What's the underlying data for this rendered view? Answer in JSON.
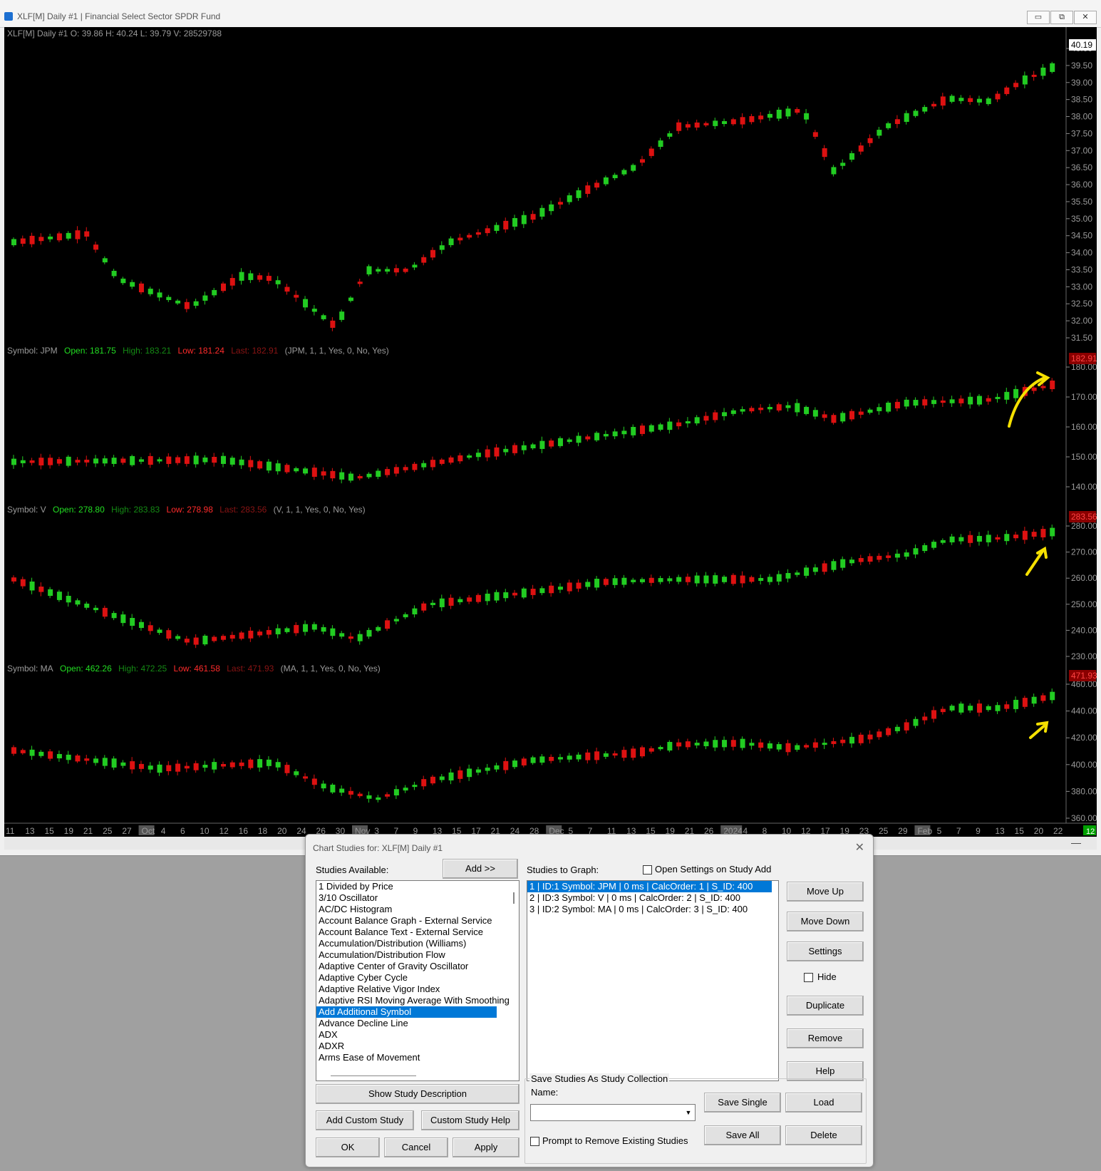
{
  "window": {
    "title": "XLF[M]  Daily #1 | Financial Select Sector SPDR Fund",
    "minimize": "▭",
    "restore": "⧉",
    "close": "✕"
  },
  "chart": {
    "main_header": "XLF[M]  Daily #1 O: 39.86 H: 40.24 L: 39.79 V: 28529788",
    "last_price_label": "40.19",
    "studies": [
      {
        "symbol_label": "Symbol: JPM",
        "open": "Open: 181.75",
        "high": "High: 183.21",
        "low": "Low: 181.24",
        "last": "Last: 182.91",
        "params": "(JPM, 1, 1, Yes, 0, No, Yes)",
        "price_label": "182.91"
      },
      {
        "symbol_label": "Symbol: V",
        "open": "Open: 278.80",
        "high": "High: 283.83",
        "low": "Low: 278.98",
        "last": "Last: 283.56",
        "params": "(V, 1, 1, Yes, 0, No, Yes)",
        "price_label": "283.56"
      },
      {
        "symbol_label": "Symbol: MA",
        "open": "Open: 462.26",
        "high": "High: 472.25",
        "low": "Low: 461.58",
        "last": "Last: 471.93",
        "params": "(MA, 1, 1, Yes, 0, No, Yes)",
        "price_label": "471.93"
      }
    ],
    "axis_main": [
      "40.00",
      "39.50",
      "39.00",
      "38.50",
      "38.00",
      "37.50",
      "37.00",
      "36.50",
      "36.00",
      "35.50",
      "35.00",
      "34.50",
      "34.00",
      "33.50",
      "33.00",
      "32.50",
      "32.00",
      "31.50"
    ],
    "axis_jpm": [
      "180.00",
      "170.00",
      "160.00",
      "150.00",
      "140.00"
    ],
    "axis_v": [
      "280.00",
      "270.00",
      "260.00",
      "250.00",
      "240.00",
      "230.00"
    ],
    "axis_ma": [
      "460.00",
      "440.00",
      "420.00",
      "400.00",
      "380.00",
      "360.00"
    ],
    "date_labels": [
      "11",
      "13",
      "15",
      "19",
      "21",
      "25",
      "27",
      "Oct",
      "4",
      "6",
      "10",
      "12",
      "16",
      "18",
      "20",
      "24",
      "26",
      "30",
      "Nov",
      "3",
      "7",
      "9",
      "13",
      "15",
      "17",
      "21",
      "24",
      "28",
      "Dec",
      "5",
      "7",
      "11",
      "13",
      "15",
      "19",
      "21",
      "26",
      "2024",
      "4",
      "8",
      "10",
      "12",
      "17",
      "19",
      "23",
      "25",
      "29",
      "Feb",
      "5",
      "7",
      "9",
      "13",
      "15",
      "20",
      "22"
    ],
    "bar_count": "12",
    "colors": {
      "up": "#22cc22",
      "down": "#dd1111",
      "background": "#000000",
      "annotation": "#f5e000"
    }
  },
  "dialog": {
    "title": "Chart Studies for: XLF[M]  Daily #1",
    "studies_available_label": "Studies Available:",
    "add_button": "Add >>",
    "studies_to_graph_label": "Studies to Graph:",
    "open_settings_label": "Open Settings on Study Add",
    "available": [
      "1 Divided by Price",
      "3/10 Oscillator",
      "AC/DC Histogram",
      "Account Balance Graph - External Service",
      "Account Balance Text - External Service",
      "Accumulation/Distribution (Williams)",
      "Accumulation/Distribution Flow",
      "Adaptive Center of Gravity Oscillator",
      "Adaptive Cyber Cycle",
      "Adaptive Relative Vigor Index",
      "Adaptive RSI Moving Average With Smoothing",
      "Add Additional Symbol",
      "Advance Decline Line",
      "ADX",
      "ADXR",
      "Arms Ease of Movement"
    ],
    "selected_available": "Add Additional Symbol",
    "graph_studies": [
      "1 | ID:1  Symbol: JPM | 0 ms | CalcOrder: 1 | S_ID: 400",
      "2 | ID:3  Symbol: V | 0 ms | CalcOrder: 2 | S_ID: 400",
      "3 | ID:2  Symbol: MA | 0 ms | CalcOrder: 3 | S_ID: 400"
    ],
    "move_up": "Move Up",
    "move_down": "Move Down",
    "settings": "Settings",
    "hide": "Hide",
    "duplicate": "Duplicate",
    "remove": "Remove",
    "help": "Help",
    "show_desc": "Show Study Description",
    "add_custom": "Add Custom Study",
    "custom_help": "Custom Study Help",
    "ok": "OK",
    "cancel": "Cancel",
    "apply": "Apply",
    "collection_label": "Save Studies As Study Collection",
    "name_label": "Name:",
    "name_value": "",
    "save_single": "Save Single",
    "load": "Load",
    "save_all": "Save All",
    "delete": "Delete",
    "prompt_label": "Prompt to Remove Existing Studies"
  }
}
